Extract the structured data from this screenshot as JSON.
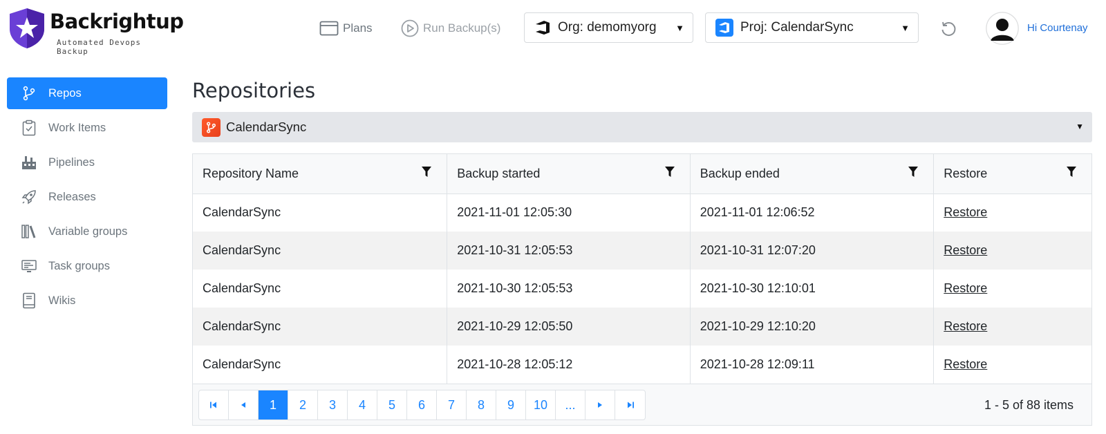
{
  "header": {
    "logo_name": "Backrightup",
    "logo_tagline": "Automated Devops Backup",
    "plans_label": "Plans",
    "run_backup_label": "Run Backup(s)",
    "org_label": "Org: demomyorg",
    "project_label": "Proj: CalendarSync",
    "greeting_hi": "Hi",
    "user_name": "Courtenay"
  },
  "sidebar": {
    "items": [
      {
        "label": "Repos",
        "icon": "branch-icon",
        "active": true
      },
      {
        "label": "Work Items",
        "icon": "clipboard-icon"
      },
      {
        "label": "Pipelines",
        "icon": "factory-icon"
      },
      {
        "label": "Releases",
        "icon": "rocket-icon"
      },
      {
        "label": "Variable groups",
        "icon": "library-icon"
      },
      {
        "label": "Task groups",
        "icon": "monitor-icon"
      },
      {
        "label": "Wikis",
        "icon": "book-icon"
      }
    ]
  },
  "main": {
    "title": "Repositories",
    "repo_selected": "CalendarSync",
    "columns": [
      "Repository Name",
      "Backup started",
      "Backup ended",
      "Restore"
    ],
    "rows": [
      {
        "name": "CalendarSync",
        "started": "2021-11-01 12:05:30",
        "ended": "2021-11-01 12:06:52",
        "restore": "Restore"
      },
      {
        "name": "CalendarSync",
        "started": "2021-10-31 12:05:53",
        "ended": "2021-10-31 12:07:20",
        "restore": "Restore"
      },
      {
        "name": "CalendarSync",
        "started": "2021-10-30 12:05:53",
        "ended": "2021-10-30 12:10:01",
        "restore": "Restore"
      },
      {
        "name": "CalendarSync",
        "started": "2021-10-29 12:05:50",
        "ended": "2021-10-29 12:10:20",
        "restore": "Restore"
      },
      {
        "name": "CalendarSync",
        "started": "2021-10-28 12:05:12",
        "ended": "2021-10-28 12:09:11",
        "restore": "Restore"
      }
    ],
    "pager": {
      "pages": [
        "1",
        "2",
        "3",
        "4",
        "5",
        "6",
        "7",
        "8",
        "9",
        "10",
        "..."
      ],
      "current_page": "1",
      "info": "1 - 5 of 88 items"
    }
  },
  "colors": {
    "accent": "#1a85ff",
    "logo_purple": "#5b2fc9",
    "repo_icon_orange": "#f05a28"
  }
}
